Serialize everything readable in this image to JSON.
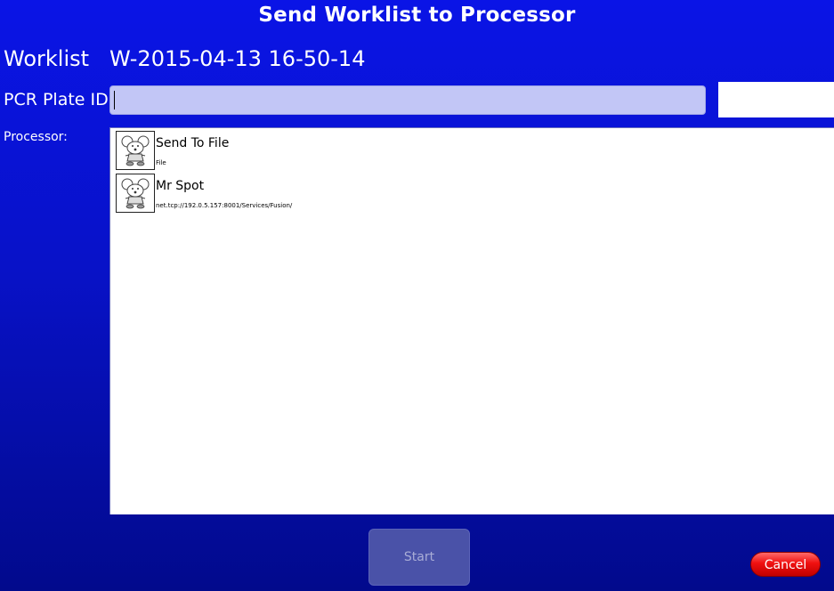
{
  "window": {
    "title": "Send Worklist to Processor"
  },
  "worklist": {
    "label": "Worklist",
    "value": "W-2015-04-13 16-50-14"
  },
  "pcr_plate": {
    "label": "PCR Plate ID",
    "value": ""
  },
  "processor": {
    "label": "Processor:",
    "items": [
      {
        "name": "Send To File",
        "address": "File",
        "icon": "mouse-mascot-icon"
      },
      {
        "name": "Mr Spot",
        "address": "net.tcp://192.0.5.157:8001/Services/Fusion/",
        "icon": "mouse-mascot-icon"
      }
    ]
  },
  "actions": {
    "start_label": "Start",
    "cancel_label": "Cancel"
  },
  "colors": {
    "background_top": "#0a14e6",
    "background_bottom": "#020a8c",
    "input_fill": "#c2c6f6",
    "cancel_red": "#f01010",
    "start_disabled": "#4a52a8"
  }
}
